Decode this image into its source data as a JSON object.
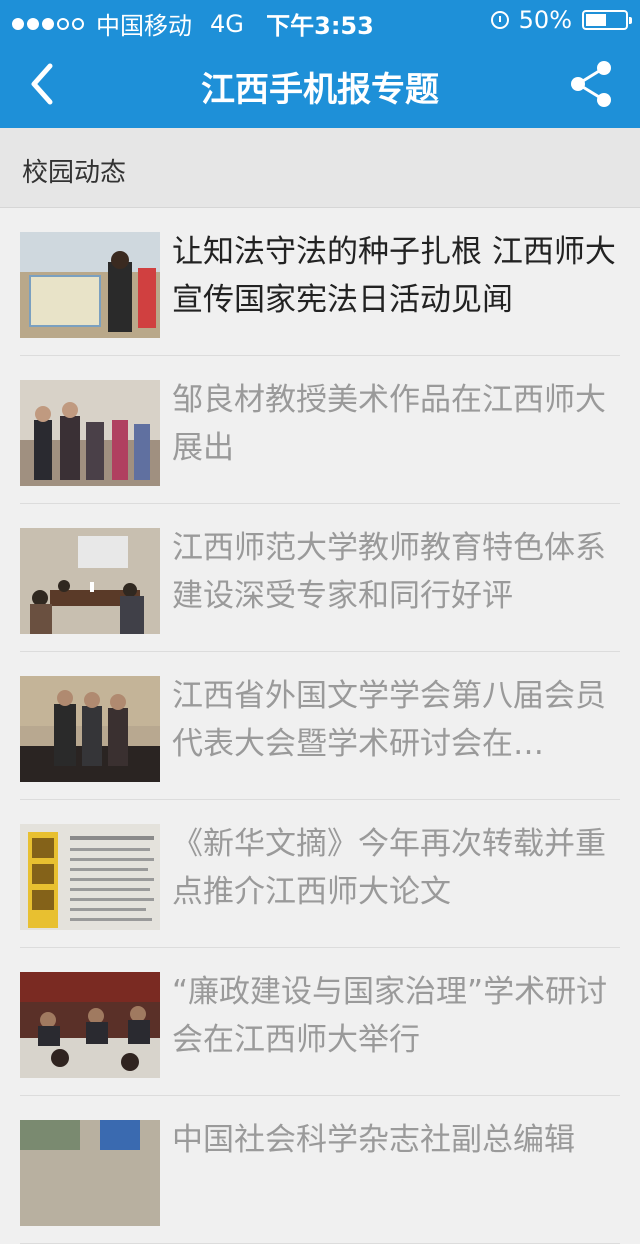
{
  "status_bar": {
    "carrier": "中国移动",
    "network": "4G",
    "time": "下午3:53",
    "battery": "50%",
    "battery_level": 0.5,
    "signal_bars_filled": 3,
    "signal_bars_total": 5
  },
  "nav": {
    "title": "江西手机报专题",
    "back_icon": "chevron-left-icon",
    "share_icon": "share-icon"
  },
  "section": {
    "title": "校园动态"
  },
  "articles": [
    {
      "title": "让知法守法的种子扎根 江西师大宣传国家宪法日活动见闻",
      "unread": true,
      "thumb_color": "#9a8a6e"
    },
    {
      "title": "邹良材教授美术作品在江西师大展出",
      "unread": false,
      "thumb_color": "#8c7a72"
    },
    {
      "title": "江西师范大学教师教育特色体系建设深受专家和同行好评",
      "unread": false,
      "thumb_color": "#6b5a48"
    },
    {
      "title": "江西省外国文学学会第八届会员代表大会暨学术研讨会在…",
      "unread": false,
      "thumb_color": "#7d6a58"
    },
    {
      "title": "《新华文摘》今年再次转载并重点推介江西师大论文",
      "unread": false,
      "thumb_color": "#c8c4b8"
    },
    {
      "title": "“廉政建设与国家治理”学术研讨会在江西师大举行",
      "unread": false,
      "thumb_color": "#5a3a30"
    },
    {
      "title": "中国社会科学杂志社副总编辑",
      "unread": false,
      "thumb_color": "#b8b0a0"
    }
  ]
}
